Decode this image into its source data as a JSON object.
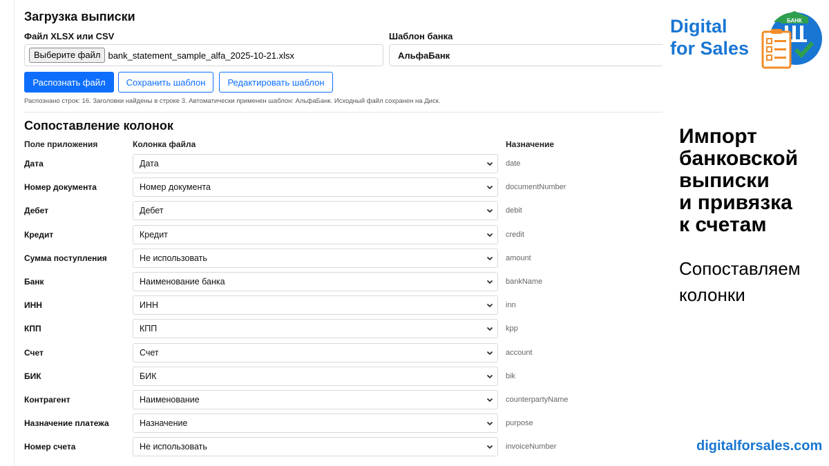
{
  "upload": {
    "title": "Загрузка выписки",
    "file_label": "Файл XLSX или CSV",
    "file_button": "Выберите файл",
    "file_name": "bank_statement_sample_alfa_2025-10-21.xlsx",
    "template_label": "Шаблон банка",
    "template_value": "АльфаБанк",
    "buttons": {
      "recognize": "Распознать файл",
      "save_template": "Сохранить шаблон",
      "edit_template": "Редактировать шаблон"
    },
    "status": "Распознано строк: 16. Заголовки найдены в строке 3. Автоматически применен шаблон: АльфаБанк. Исходный файл сохранен на Диск."
  },
  "mapping": {
    "title": "Сопоставление колонок",
    "headers": {
      "app_field": "Поле приложения",
      "file_column": "Колонка файла",
      "destination": "Назначение"
    },
    "rows": [
      {
        "field": "Дата",
        "column": "Дата",
        "dest": "date"
      },
      {
        "field": "Номер документа",
        "column": "Номер документа",
        "dest": "documentNumber"
      },
      {
        "field": "Дебет",
        "column": "Дебет",
        "dest": "debit"
      },
      {
        "field": "Кредит",
        "column": "Кредит",
        "dest": "credit"
      },
      {
        "field": "Сумма поступления",
        "column": "Не использовать",
        "dest": "amount"
      },
      {
        "field": "Банк",
        "column": "Наименование банка",
        "dest": "bankName"
      },
      {
        "field": "ИНН",
        "column": "ИНН",
        "dest": "inn"
      },
      {
        "field": "КПП",
        "column": "КПП",
        "dest": "kpp"
      },
      {
        "field": "Счет",
        "column": "Счет",
        "dest": "account"
      },
      {
        "field": "БИК",
        "column": "БИК",
        "dest": "bik"
      },
      {
        "field": "Контрагент",
        "column": "Наименование",
        "dest": "counterpartyName"
      },
      {
        "field": "Назначение платежа",
        "column": "Назначение",
        "dest": "purpose"
      },
      {
        "field": "Номер счета",
        "column": "Не использовать",
        "dest": "invoiceNumber"
      }
    ]
  },
  "promo": {
    "logo_line1": "Digital",
    "logo_line2": "for Sales",
    "logo_icon_text": "БАНК",
    "heading_lines": [
      "Импорт",
      "банковской",
      "выписки",
      "и привязка",
      "к счетам"
    ],
    "subheading_lines": [
      "Сопоставляем",
      "колонки"
    ],
    "site": "digitalforsales.com"
  },
  "colors": {
    "primary": "#0d6efd",
    "brand_blue": "#1976d2",
    "brand_green": "#2e9e4f",
    "brand_orange": "#f28c28"
  }
}
